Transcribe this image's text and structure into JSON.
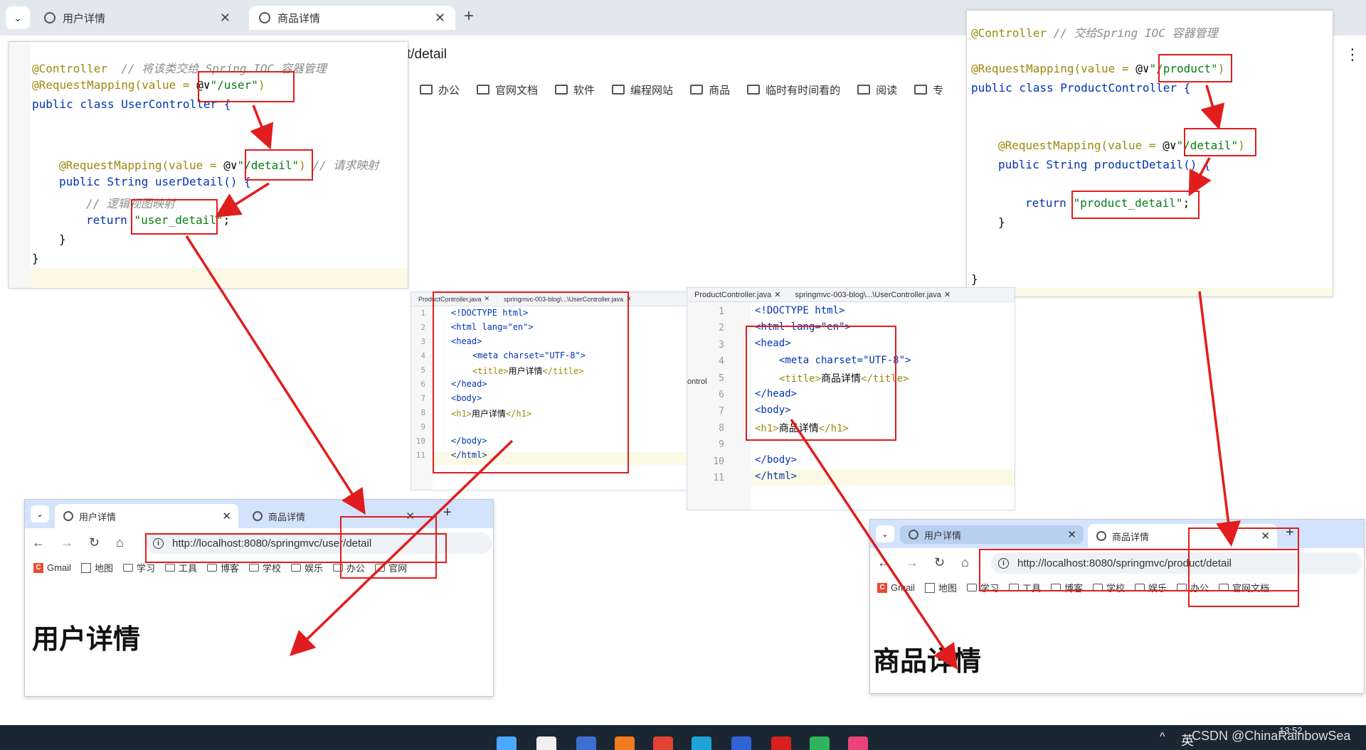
{
  "background_browser": {
    "tabs": [
      {
        "label": "用户详情",
        "active": false
      },
      {
        "label": "商品详情",
        "active": true
      }
    ],
    "url_visible_fragment": "t/detail",
    "bookmarks": [
      "办公",
      "官网文档",
      "软件",
      "编程网站",
      "商品",
      "临时有时间看的",
      "阅读",
      "专"
    ]
  },
  "user_controller": {
    "lines": [
      {
        "anno": "@Controller",
        "comment": "// 将该类交给 Spring IOC 容器管理"
      },
      {
        "anno": "@RequestMapping(value = ",
        "value": "\"/user\"",
        "end": ")"
      },
      {
        "code": "public class UserController {"
      },
      {
        "anno": "@RequestMapping(value = ",
        "value": "\"/detail\"",
        "end": ")",
        "comment": "// 请求映射"
      },
      {
        "code": "public String userDetail() {"
      },
      {
        "comment": "// 逻辑视图映射"
      },
      {
        "kw": "return ",
        "value": "\"user_detail\"",
        "end": ";"
      },
      {
        "code": "}"
      },
      {
        "code": "}"
      }
    ]
  },
  "product_controller": {
    "lines": [
      {
        "anno": "@Controller",
        "comment": "// 交给Spring IOC 容器管理"
      },
      {
        "anno": "@RequestMapping(value = ",
        "value": "\"/product\"",
        "end": ")"
      },
      {
        "code": "public class ProductController {"
      },
      {
        "anno": "@RequestMapping(value = ",
        "value": "\"/detail\"",
        "end": ")"
      },
      {
        "code": "public String productDetail() {"
      },
      {
        "kw": "return ",
        "value": "\"product_detail\"",
        "end": ";"
      },
      {
        "code": "}"
      },
      {
        "code": "}"
      }
    ]
  },
  "user_html_editor": {
    "tabs": [
      "ProductController.java",
      "springmvc-003-blog\\...\\UserController.java"
    ],
    "line_numbers": [
      "1",
      "2",
      "3",
      "4",
      "5",
      "6",
      "7",
      "8",
      "9",
      "10",
      "11"
    ],
    "title_text": "用户详情",
    "h1_text": "用户详情"
  },
  "product_html_editor": {
    "tabs": [
      "ProductController.java",
      "springmvc-003-blog\\...\\UserController.java"
    ],
    "line_numbers": [
      "1",
      "2",
      "3",
      "4",
      "5",
      "6",
      "7",
      "8",
      "9",
      "10",
      "11"
    ],
    "title_text": "商品详情",
    "h1_text": "商品详情",
    "side_fragment": "ontrol"
  },
  "html_tokens": {
    "doctype": "<!DOCTYPE html>",
    "html_open": "<html lang=\"en\">",
    "head_open": "<head>",
    "meta": "<meta charset=\"UTF-8\">",
    "title_open": "<title>",
    "title_close": "</title>",
    "head_close": "</head>",
    "body_open": "<body>",
    "h1_open": "<h1>",
    "h1_close": "</h1>",
    "body_close": "</body>",
    "html_close": "</html>"
  },
  "user_browser": {
    "tabs": [
      "用户详情",
      "商品详情"
    ],
    "url": "http://localhost:8080/springmvc/user/detail",
    "bookmarks": [
      "Gmail",
      "地图",
      "学习",
      "工具",
      "博客",
      "学校",
      "娱乐",
      "办公",
      "官网"
    ],
    "heading": "用户详情"
  },
  "product_browser": {
    "tabs": [
      "用户详情",
      "商品详情"
    ],
    "url": "http://localhost:8080/springmvc/product/detail",
    "bookmarks": [
      "Gmail",
      "地图",
      "学习",
      "工具",
      "博客",
      "学校",
      "娱乐",
      "办公",
      "官网文档"
    ],
    "heading": "商品详情"
  },
  "taskbar": {
    "ime": "英",
    "watermark": "CSDN @ChinaRainbowSea",
    "time": "13:52"
  },
  "colors": {
    "annotation_red": "#e11d1d",
    "keyword_blue": "#0033b3",
    "string_green": "#067d17",
    "annotation_olive": "#9e880d"
  }
}
